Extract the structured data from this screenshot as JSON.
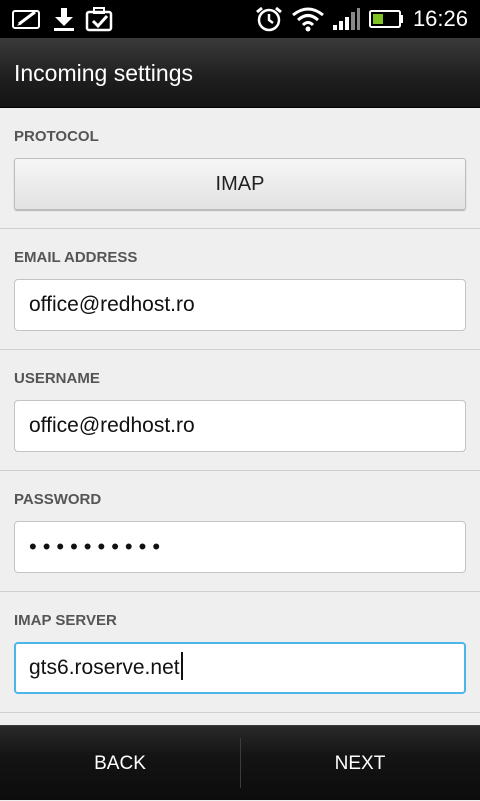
{
  "status_bar": {
    "time": "16:26",
    "icons": [
      "edit-note-icon",
      "download-icon",
      "briefcase-check-icon",
      "alarm-clock-icon",
      "wifi-icon",
      "signal-icon",
      "battery-charging-icon"
    ],
    "battery_level": 0.4,
    "battery_color": "#7ec322"
  },
  "header": {
    "title": "Incoming settings"
  },
  "form": {
    "protocol": {
      "label": "PROTOCOL",
      "value": "IMAP"
    },
    "email": {
      "label": "EMAIL ADDRESS",
      "value": "office@redhost.ro"
    },
    "username": {
      "label": "USERNAME",
      "value": "office@redhost.ro"
    },
    "password": {
      "label": "PASSWORD",
      "value": "••••••••••"
    },
    "imap_server": {
      "label": "IMAP SERVER",
      "value": "gts6.roserve.net"
    }
  },
  "footer": {
    "back_label": "BACK",
    "next_label": "NEXT"
  },
  "colors": {
    "focus_border": "#4db6e8",
    "background": "#efefef"
  }
}
